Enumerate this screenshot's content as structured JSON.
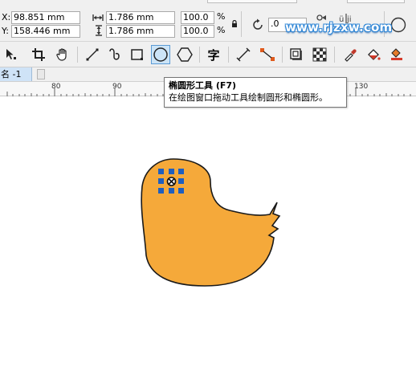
{
  "property_bar": {
    "x_label": "X:",
    "x_value": "98.851 mm",
    "y_label": "Y:",
    "y_value": "158.446 mm",
    "width_value": "1.786 mm",
    "height_value": "1.786 mm",
    "scale_w_value": "100.0",
    "scale_h_value": "100.0",
    "percent_unit": "%",
    "rotation_value": ".0",
    "icons": [
      "width-icon",
      "height-icon",
      "lock-ratio-icon",
      "rotate-icon",
      "mirror-horizontal-icon",
      "mirror-vertical-icon",
      "circle-shape-icon"
    ]
  },
  "watermark": {
    "text": "www.rjzxw.com"
  },
  "toolbar": {
    "tools": [
      {
        "name": "shape-tool",
        "active": false
      },
      {
        "name": "crop-tool",
        "active": false
      },
      {
        "name": "pan-tool",
        "active": false
      },
      {
        "name": "freehand-tool",
        "active": false
      },
      {
        "name": "artistic-media-tool",
        "active": false
      },
      {
        "name": "rectangle-tool",
        "active": false
      },
      {
        "name": "ellipse-tool",
        "active": true
      },
      {
        "name": "polygon-tool",
        "active": false
      },
      {
        "name": "text-tool",
        "active": false
      },
      {
        "name": "parallel-dimension-tool",
        "active": false
      },
      {
        "name": "connector-tool",
        "active": false
      },
      {
        "name": "drop-shadow-tool",
        "active": false
      },
      {
        "name": "transparency-tool",
        "active": false
      },
      {
        "name": "eyedropper-tool",
        "active": false
      },
      {
        "name": "interactive-fill-tool",
        "active": false
      },
      {
        "name": "smart-fill-tool",
        "active": false
      }
    ],
    "text_tool_glyph": "字"
  },
  "document": {
    "tab_label": "名 -1"
  },
  "ruler": {
    "labels": [
      "80",
      "90",
      "130"
    ]
  },
  "tooltip": {
    "title": "椭圆形工具 (F7)",
    "description": "在绘图窗口拖动工具绘制圆形和椭圆形。"
  },
  "colors": {
    "shape_fill": "#f5a93a",
    "shape_stroke": "#1a1a1a",
    "selection_handle": "#1f5fbf",
    "active_tool_bg": "#cce4f7"
  }
}
